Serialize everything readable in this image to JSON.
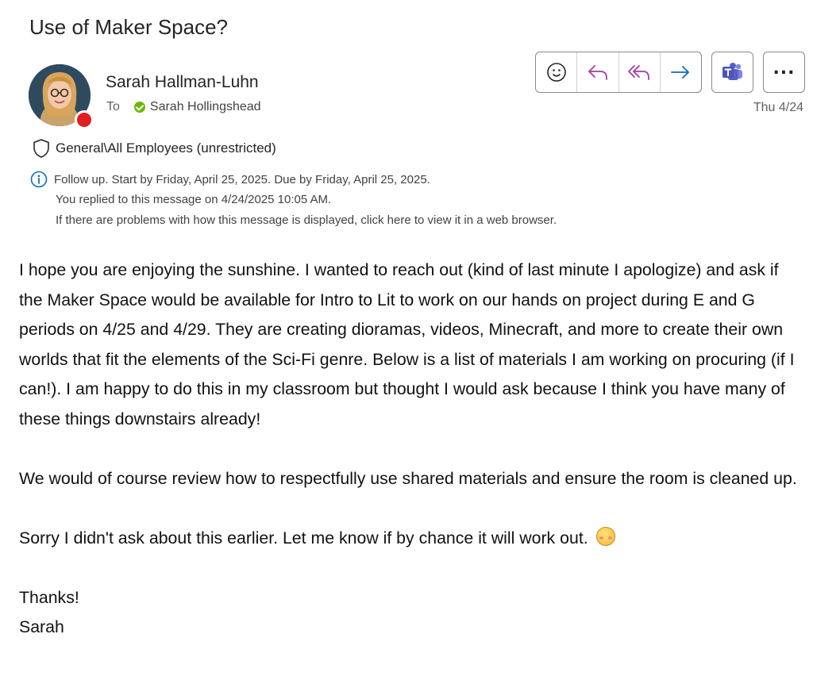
{
  "email": {
    "subject": "Use of Maker Space?",
    "sender": "Sarah Hallman-Luhn",
    "to_label": "To",
    "recipient": "Sarah Hollingshead",
    "date": "Thu 4/24",
    "sensitivity": "General\\All Employees (unrestricted)",
    "info": {
      "follow_up": "Follow up.  Start by Friday, April 25, 2025.  Due by Friday, April 25, 2025.",
      "replied": "You replied to this message on 4/24/2025 10:05 AM.",
      "display_problem": "If there are problems with how this message is displayed, click here to view it in a web browser."
    },
    "body": {
      "p1": "I hope you are enjoying the sunshine. I wanted to reach out (kind of last minute I apologize) and ask if the Maker Space would be available for Intro to Lit to work on our hands on project during E and G periods on 4/25 and 4/29. They are creating dioramas, videos, Minecraft, and more to create their own worlds that fit the elements of the Sci-Fi genre. Below is a list of materials I am working on procuring (if I can!). I am happy to do this in my classroom but thought I would ask because I think you have many of these things downstairs already!",
      "p2": "We would of course review how to respectfully use shared materials and ensure the room is cleaned up.",
      "p3": "Sorry I didn't ask about this earlier. Let me know if by chance it will work out.",
      "thanks": "Thanks!",
      "signature": "Sarah"
    }
  },
  "toolbar": {
    "icons": [
      "emoji-react-icon",
      "reply-icon",
      "reply-all-icon",
      "forward-icon",
      "teams-icon",
      "more-icon"
    ],
    "more_label": "..."
  },
  "colors": {
    "accent_purple": "#a43ba8",
    "forward_blue": "#0f6cbd",
    "teams": "#5b5fc7",
    "presence_busy": "#e02020",
    "status_available": "#6bb700",
    "info_blue": "#0f6cbd"
  }
}
